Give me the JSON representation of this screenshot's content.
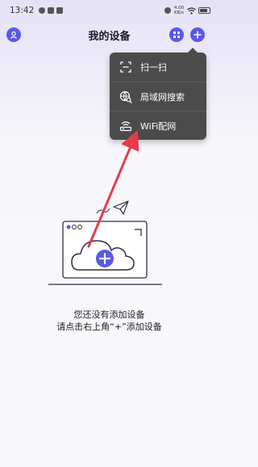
{
  "status_bar": {
    "time": "13:42",
    "net_speed_value": "4.00",
    "net_speed_unit": "KB/s"
  },
  "header": {
    "title": "我的设备"
  },
  "dropdown_menu": {
    "items": [
      {
        "label": "扫一扫",
        "icon": "scan-icon"
      },
      {
        "label": "局域网搜索",
        "icon": "lan-search-icon"
      },
      {
        "label": "WiFi配网",
        "icon": "router-icon"
      }
    ]
  },
  "empty_state": {
    "line1": "您还没有添加设备",
    "line2": "请点击右上角“+”添加设备"
  },
  "colors": {
    "accent": "#5a58e8",
    "menu_bg": "#4b4b4b",
    "annotation_arrow": "#e83a4a"
  }
}
